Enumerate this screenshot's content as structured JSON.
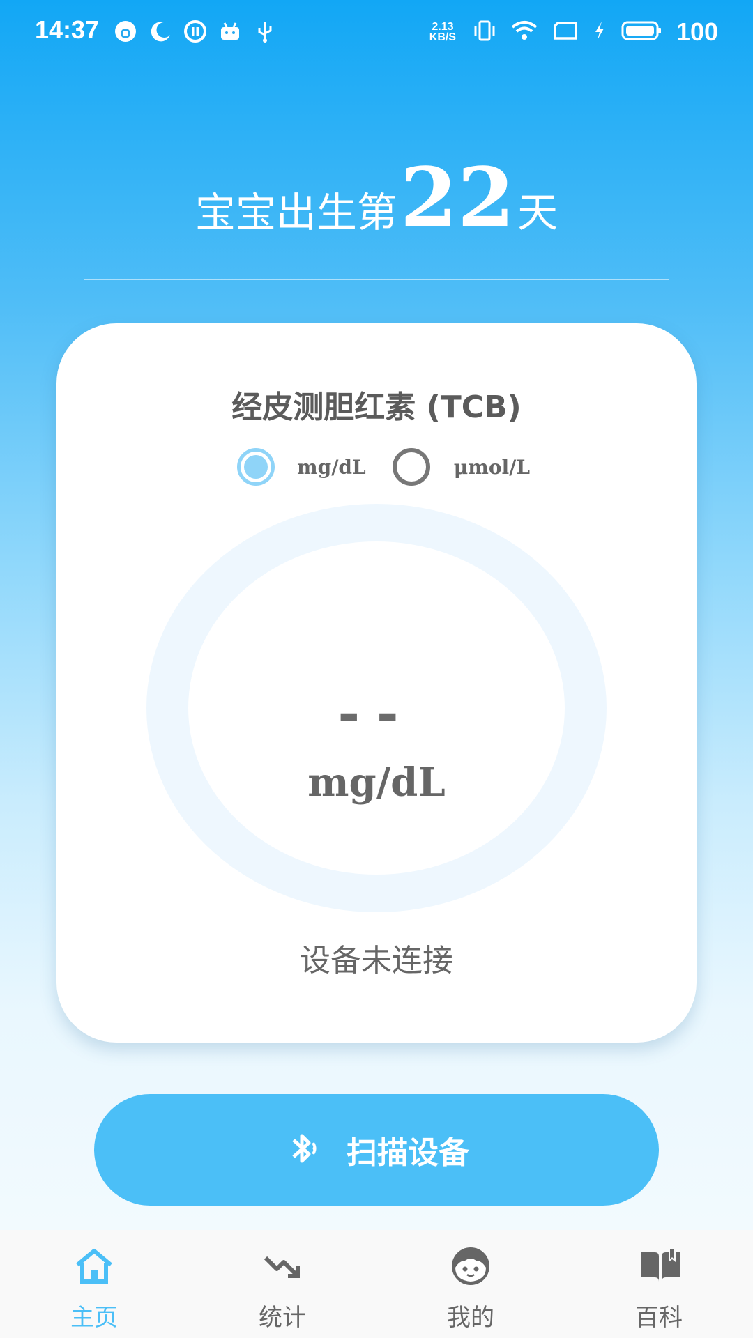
{
  "status_bar": {
    "time": "14:37",
    "net_speed_value": "2.13",
    "net_speed_unit": "KB/S",
    "battery": "100",
    "left_icons": [
      "face-icon",
      "moon-icon",
      "pause-circle-icon",
      "android-icon",
      "usb-icon"
    ],
    "right_icons": [
      "vibrate-icon",
      "wifi-icon",
      "sim-icon",
      "charging-icon",
      "battery-icon"
    ]
  },
  "header": {
    "prefix": "宝宝出生第",
    "days": "22",
    "suffix": "天"
  },
  "card": {
    "title": "经皮测胆红素 (TCB)",
    "units": [
      {
        "label": "mg/dL",
        "selected": true
      },
      {
        "label": "μmol/L",
        "selected": false
      }
    ],
    "reading": "--",
    "reading_unit": "mg/dL",
    "device_status": "设备未连接"
  },
  "scan_button": {
    "label": "扫描设备",
    "icon": "bluetooth-search-icon"
  },
  "nav": {
    "items": [
      {
        "label": "主页",
        "icon": "home-icon",
        "active": true
      },
      {
        "label": "统计",
        "icon": "trend-down-icon",
        "active": false
      },
      {
        "label": "我的",
        "icon": "face-icon",
        "active": false
      },
      {
        "label": "百科",
        "icon": "book-icon",
        "active": false
      }
    ]
  },
  "colors": {
    "accent": "#4bbff7",
    "header_gradient_top": "#12a7f5",
    "radio_selected": "#8fd4f8",
    "text_gray": "#666666"
  }
}
